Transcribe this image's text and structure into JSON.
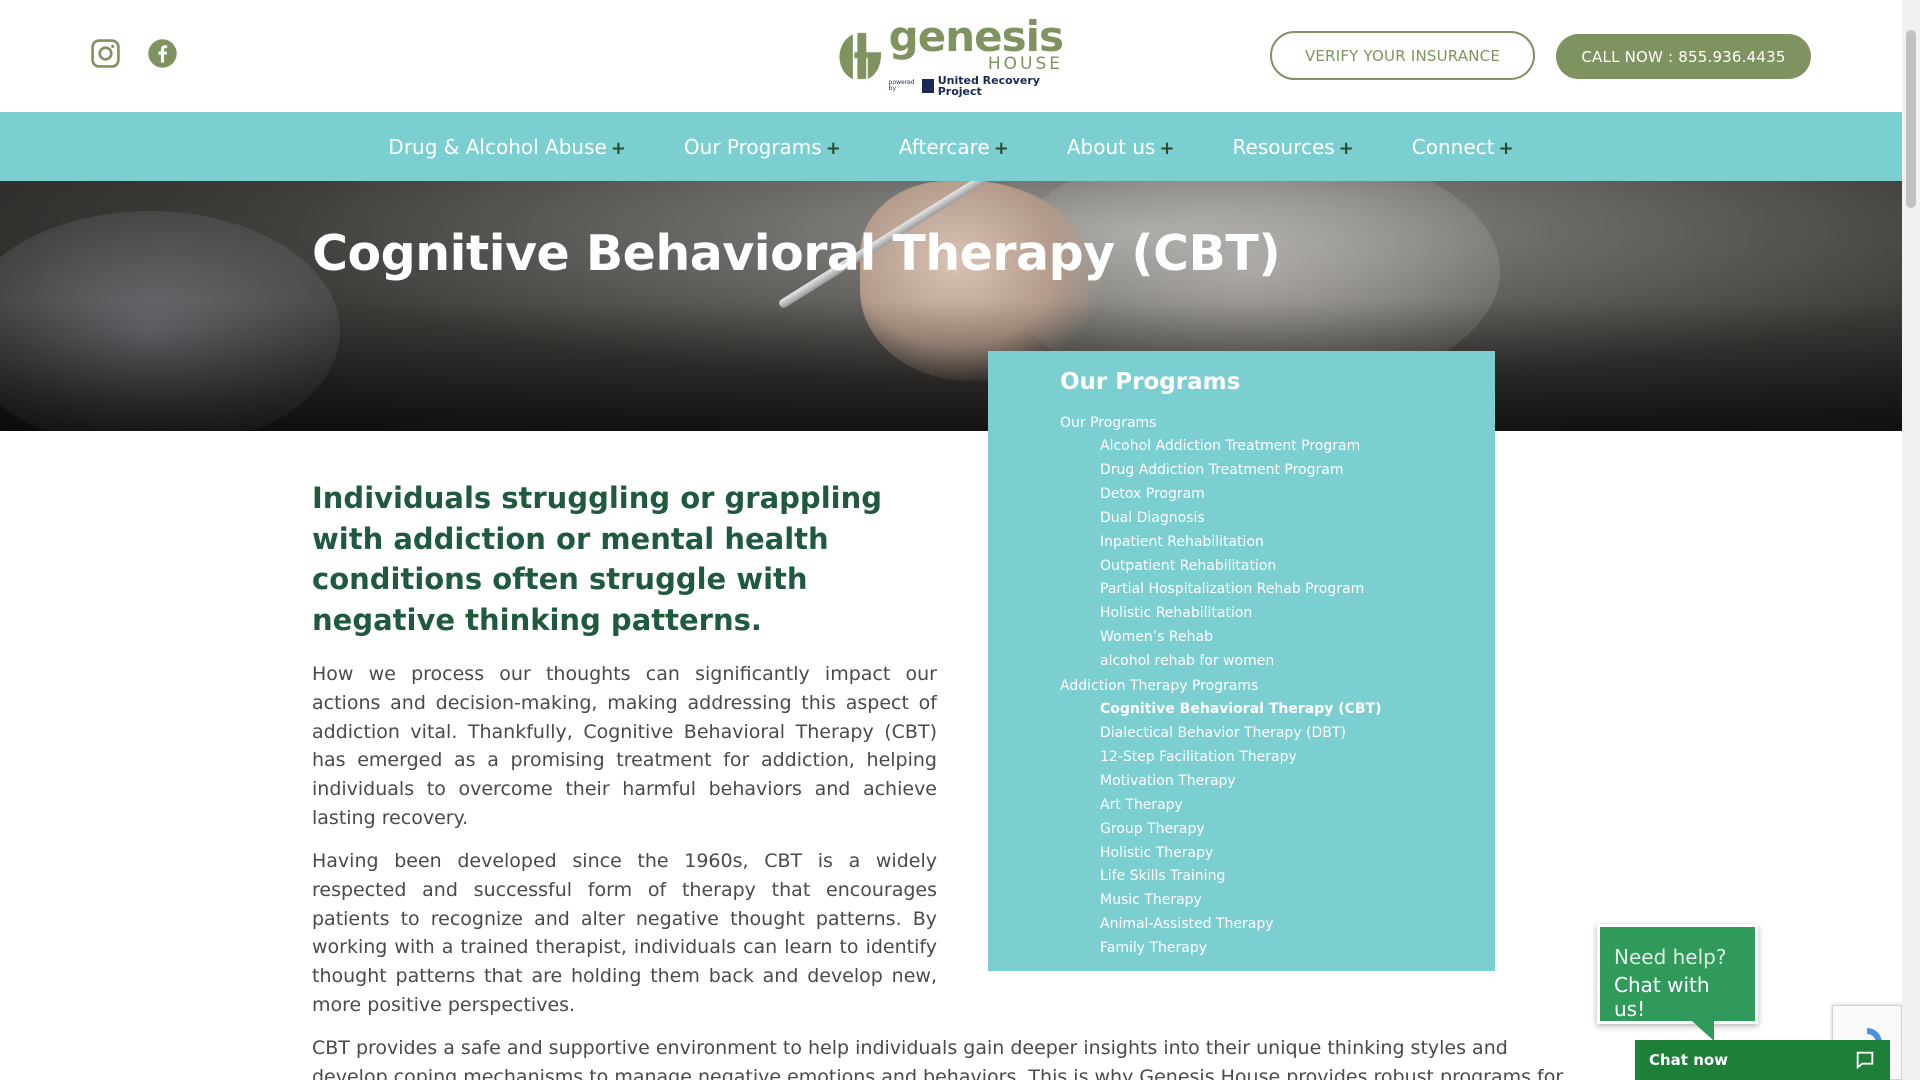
{
  "header": {
    "social": [
      {
        "icon": "instagram-icon"
      },
      {
        "icon": "facebook-icon"
      }
    ],
    "logo": {
      "word1": "genesis",
      "word2": "HOUSE",
      "powered_by": "powered by",
      "org": "United Recovery Project"
    },
    "verify_label": "VERIFY YOUR INSURANCE",
    "call_label": "CALL NOW : 855.936.4435",
    "colors": {
      "brand_green": "#7f9360",
      "nav_teal": "#7ccfd0"
    }
  },
  "nav": {
    "items": [
      {
        "label": "Drug & Alcohol Abuse",
        "plus": "+"
      },
      {
        "label": "Our Programs",
        "plus": "+"
      },
      {
        "label": "Aftercare",
        "plus": "+"
      },
      {
        "label": "About us",
        "plus": "+"
      },
      {
        "label": "Resources",
        "plus": "+"
      },
      {
        "label": "Connect",
        "plus": "+"
      }
    ]
  },
  "hero": {
    "title": "Cognitive Behavioral Therapy (CBT)"
  },
  "sidebar": {
    "heading": "Our Programs",
    "groups": [
      {
        "label": "Our Programs",
        "items": [
          "Alcohol Addiction Treatment Program",
          "Drug Addiction Treatment Program",
          "Detox Program",
          "Dual Diagnosis",
          "Inpatient Rehabilitation",
          "Outpatient Rehabilitation",
          "Partial Hospitalization Rehab Program",
          "Holistic Rehabilitation",
          "Women’s Rehab",
          "alcohol rehab for women"
        ]
      },
      {
        "label": "Addiction Therapy Programs",
        "items": [
          "Cognitive Behavioral Therapy (CBT)",
          "Dialectical Behavior Therapy (DBT)",
          "12-Step Facilitation Therapy",
          "Motivation Therapy",
          "Art Therapy",
          "Group Therapy",
          "Holistic Therapy",
          "Life Skills Training",
          "Music Therapy",
          "Animal-Assisted Therapy",
          "Family Therapy"
        ]
      }
    ],
    "active_item": "Cognitive Behavioral Therapy (CBT)"
  },
  "content": {
    "intro": "Individuals struggling or grappling with addiction or mental health conditions often struggle with negative thinking patterns.",
    "p1": "How we process our thoughts can significantly impact our actions and decision-making, making addressing this aspect of addiction vital. Thankfully, Cognitive Behavioral Therapy (CBT) has emerged as a promising treatment for addiction, helping individuals to overcome their harmful behaviors and achieve lasting recovery.",
    "p2": "Having been developed since the 1960s, CBT is a widely respected and successful form of therapy that encourages patients to recognize and alter negative thought patterns. By working with a trained therapist, individuals can learn to identify thought patterns that are holding them back and develop new, more positive perspectives.",
    "p3": "CBT provides a safe and supportive environment to help individuals gain deeper insights into their unique thinking styles and develop coping mechanisms to manage negative emotions and behaviors. This is why Genesis House provides robust programs for"
  },
  "chat": {
    "bubble_line1": "Need help?",
    "bubble_line2": "Chat with us!",
    "bar_label": "Chat now",
    "icon": "chat-icon"
  }
}
